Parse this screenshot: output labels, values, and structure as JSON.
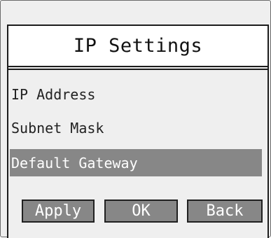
{
  "screen": {
    "title": "IP Settings"
  },
  "menu": {
    "items": [
      {
        "label": "IP Address",
        "selected": false
      },
      {
        "label": "Subnet Mask",
        "selected": false
      },
      {
        "label": "Default Gateway",
        "selected": true
      }
    ]
  },
  "buttons": {
    "apply_label": "Apply",
    "ok_label": "OK",
    "back_label": "Back"
  },
  "colors": {
    "highlight": "#878787",
    "title_background": "#ffffff",
    "panel_background": "#efefef",
    "border": "#1c1c1c"
  }
}
